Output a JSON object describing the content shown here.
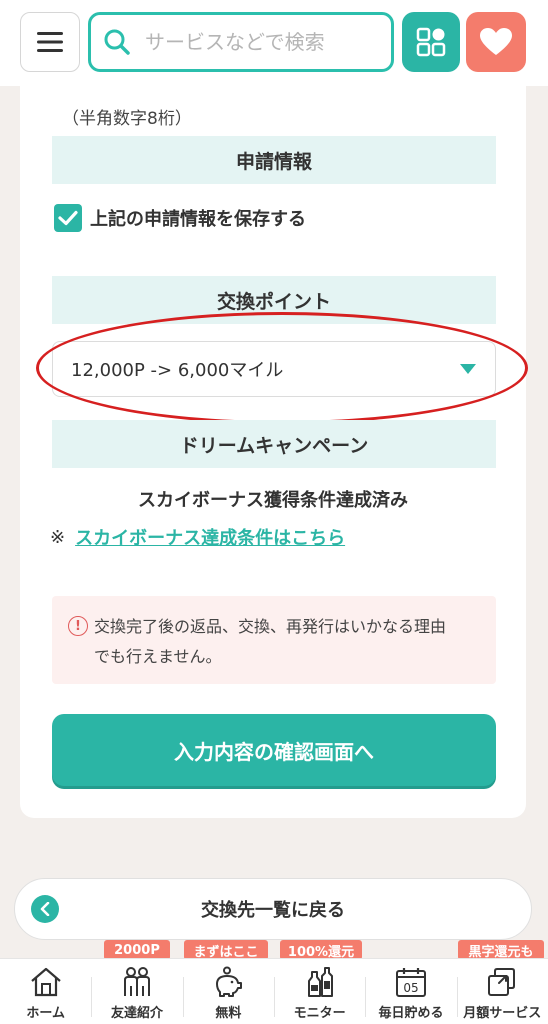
{
  "header": {
    "search_placeholder": "サービスなどで検索"
  },
  "form": {
    "note": "（半角数字8桁）",
    "application_info_heading": "申請情報",
    "save_checkbox_label": "上記の申請情報を保存する",
    "save_checked": true,
    "exchange_points_heading": "交換ポイント",
    "exchange_select_value": "12,000P -> 6,000マイル",
    "campaign_heading": "ドリームキャンペーン",
    "campaign_status": "スカイボーナス獲得条件達成済み",
    "campaign_mark": "※",
    "campaign_link": "スカイボーナス達成条件はこちら",
    "warning_text_line1": "交換完了後の返品、交換、再発行はいかなる理由",
    "warning_text_line2": "でも行えません。",
    "confirm_button": "入力内容の確認画面へ"
  },
  "back_button": "交換先一覧に戻る",
  "bottom_nav": {
    "items": [
      {
        "label": "ホーム",
        "icon": "home-icon"
      },
      {
        "label": "友達紹介",
        "icon": "friends-icon",
        "badge": "2000P"
      },
      {
        "label": "無料",
        "icon": "piggy-bank-icon",
        "badge": "まずはここ"
      },
      {
        "label": "モニター",
        "icon": "bottles-icon",
        "badge": "100%還元"
      },
      {
        "label": "毎日貯める",
        "icon": "calendar-icon",
        "calendar_day": "05"
      },
      {
        "label": "月額サービス",
        "icon": "subscription-icon",
        "badge": "黒字還元も"
      }
    ]
  },
  "colors": {
    "accent": "#2bb5a5",
    "heart": "#f47c6c",
    "annotation": "#d62020"
  }
}
